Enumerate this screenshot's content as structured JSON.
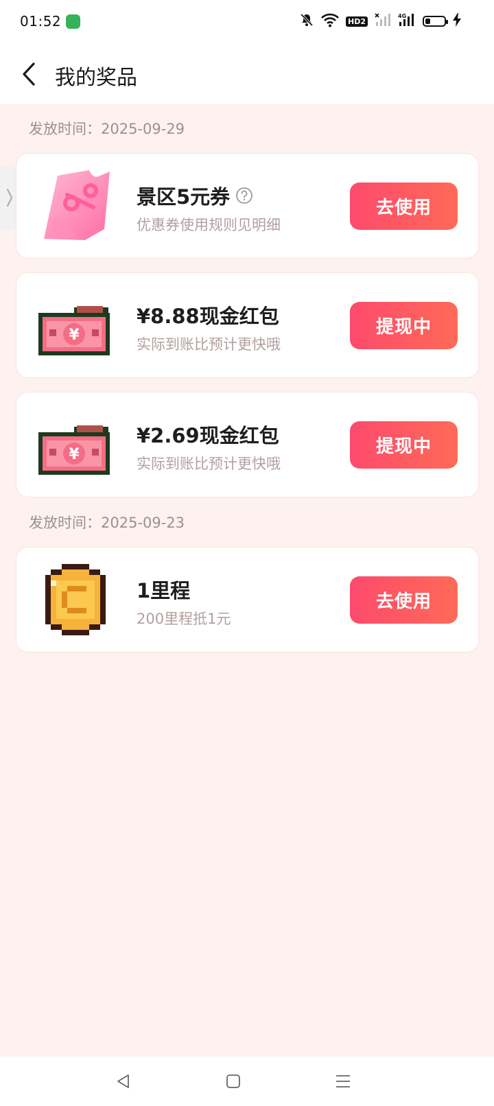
{
  "status_bar": {
    "time": "01:52",
    "hd_label": "HD2",
    "network_label": "4G"
  },
  "header": {
    "title": "我的奖品",
    "back_icon": "chevron-left-icon"
  },
  "sections": [
    {
      "date_label": "发放时间：2025-09-29"
    },
    {
      "date_label": "发放时间：2025-09-23"
    }
  ],
  "prizes": [
    {
      "title": "景区5元券",
      "subtitle": "优惠券使用规则见明细",
      "action": "去使用",
      "icon": "coupon-icon",
      "has_help": true
    },
    {
      "title": "¥8.88现金红包",
      "subtitle": "实际到账比预计更快哦",
      "action": "提现中",
      "icon": "cash-icon"
    },
    {
      "title": "¥2.69现金红包",
      "subtitle": "实际到账比预计更快哦",
      "action": "提现中",
      "icon": "cash-icon"
    },
    {
      "title": "1里程",
      "subtitle": "200里程抵1元",
      "action": "去使用",
      "icon": "coin-icon"
    }
  ],
  "colors": {
    "page_bg": "#fdf2ef",
    "button_start": "#fd4a6d",
    "button_end": "#fe6a57",
    "subtitle": "#b29f9f"
  },
  "battery_level": 0.25
}
